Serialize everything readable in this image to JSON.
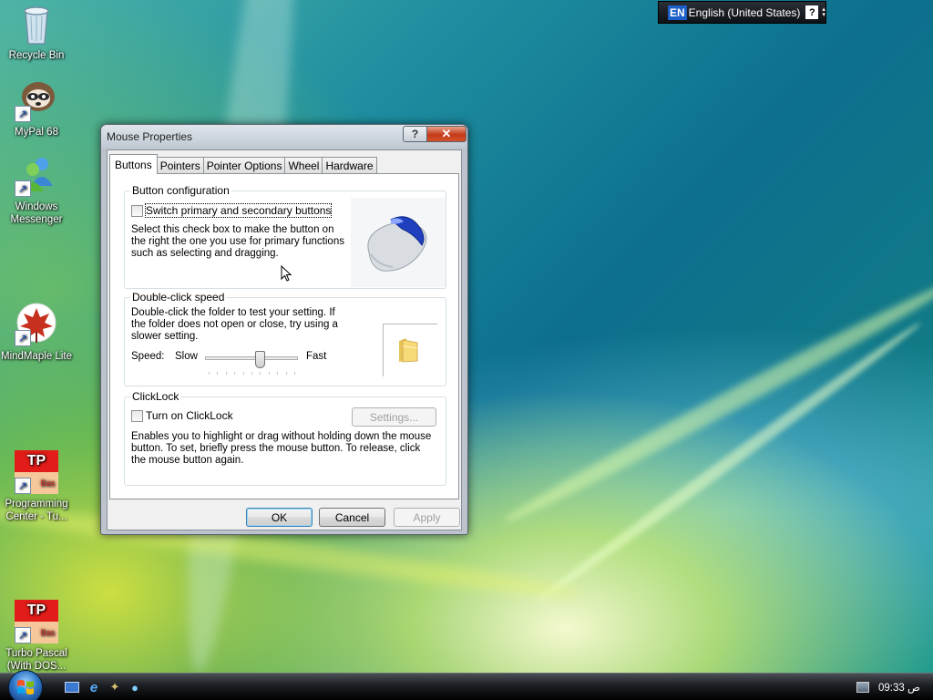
{
  "desktop": {
    "icons": [
      {
        "label": "Recycle Bin"
      },
      {
        "label": "MyPal 68"
      },
      {
        "label": "Windows Messenger"
      },
      {
        "label": "MindMaple Lite"
      },
      {
        "label": "Programming Center -  Tu..."
      },
      {
        "label": "Turbo Pascal (With DOS..."
      }
    ]
  },
  "language_bar": {
    "code": "EN",
    "language": "English (United States)",
    "help": "?"
  },
  "dialog": {
    "title": "Mouse Properties",
    "help_button": "?",
    "close_button": "✕",
    "tabs": [
      "Buttons",
      "Pointers",
      "Pointer Options",
      "Wheel",
      "Hardware"
    ],
    "active_tab": "Buttons",
    "button_configuration": {
      "title": "Button configuration",
      "checkbox_label": "Switch primary and secondary buttons",
      "checked": false,
      "description": "Select this check box to make the button on the right the one you use for primary functions such as selecting and dragging."
    },
    "double_click": {
      "title": "Double-click speed",
      "description": "Double-click the folder to test your setting. If the folder does not open or close, try using a slower setting.",
      "speed_label": "Speed:",
      "slow_label": "Slow",
      "fast_label": "Fast",
      "speed_level": 0.6
    },
    "clicklock": {
      "title": "ClickLock",
      "checkbox_label": "Turn on ClickLock",
      "checked": false,
      "settings_button": "Settings...",
      "description": "Enables you to highlight or drag without holding down the mouse button. To set, briefly press the mouse button. To release, click the mouse button again."
    },
    "buttons": {
      "ok": "OK",
      "cancel": "Cancel",
      "apply": "Apply"
    }
  },
  "taskbar": {
    "clock": "09:33 ص"
  }
}
